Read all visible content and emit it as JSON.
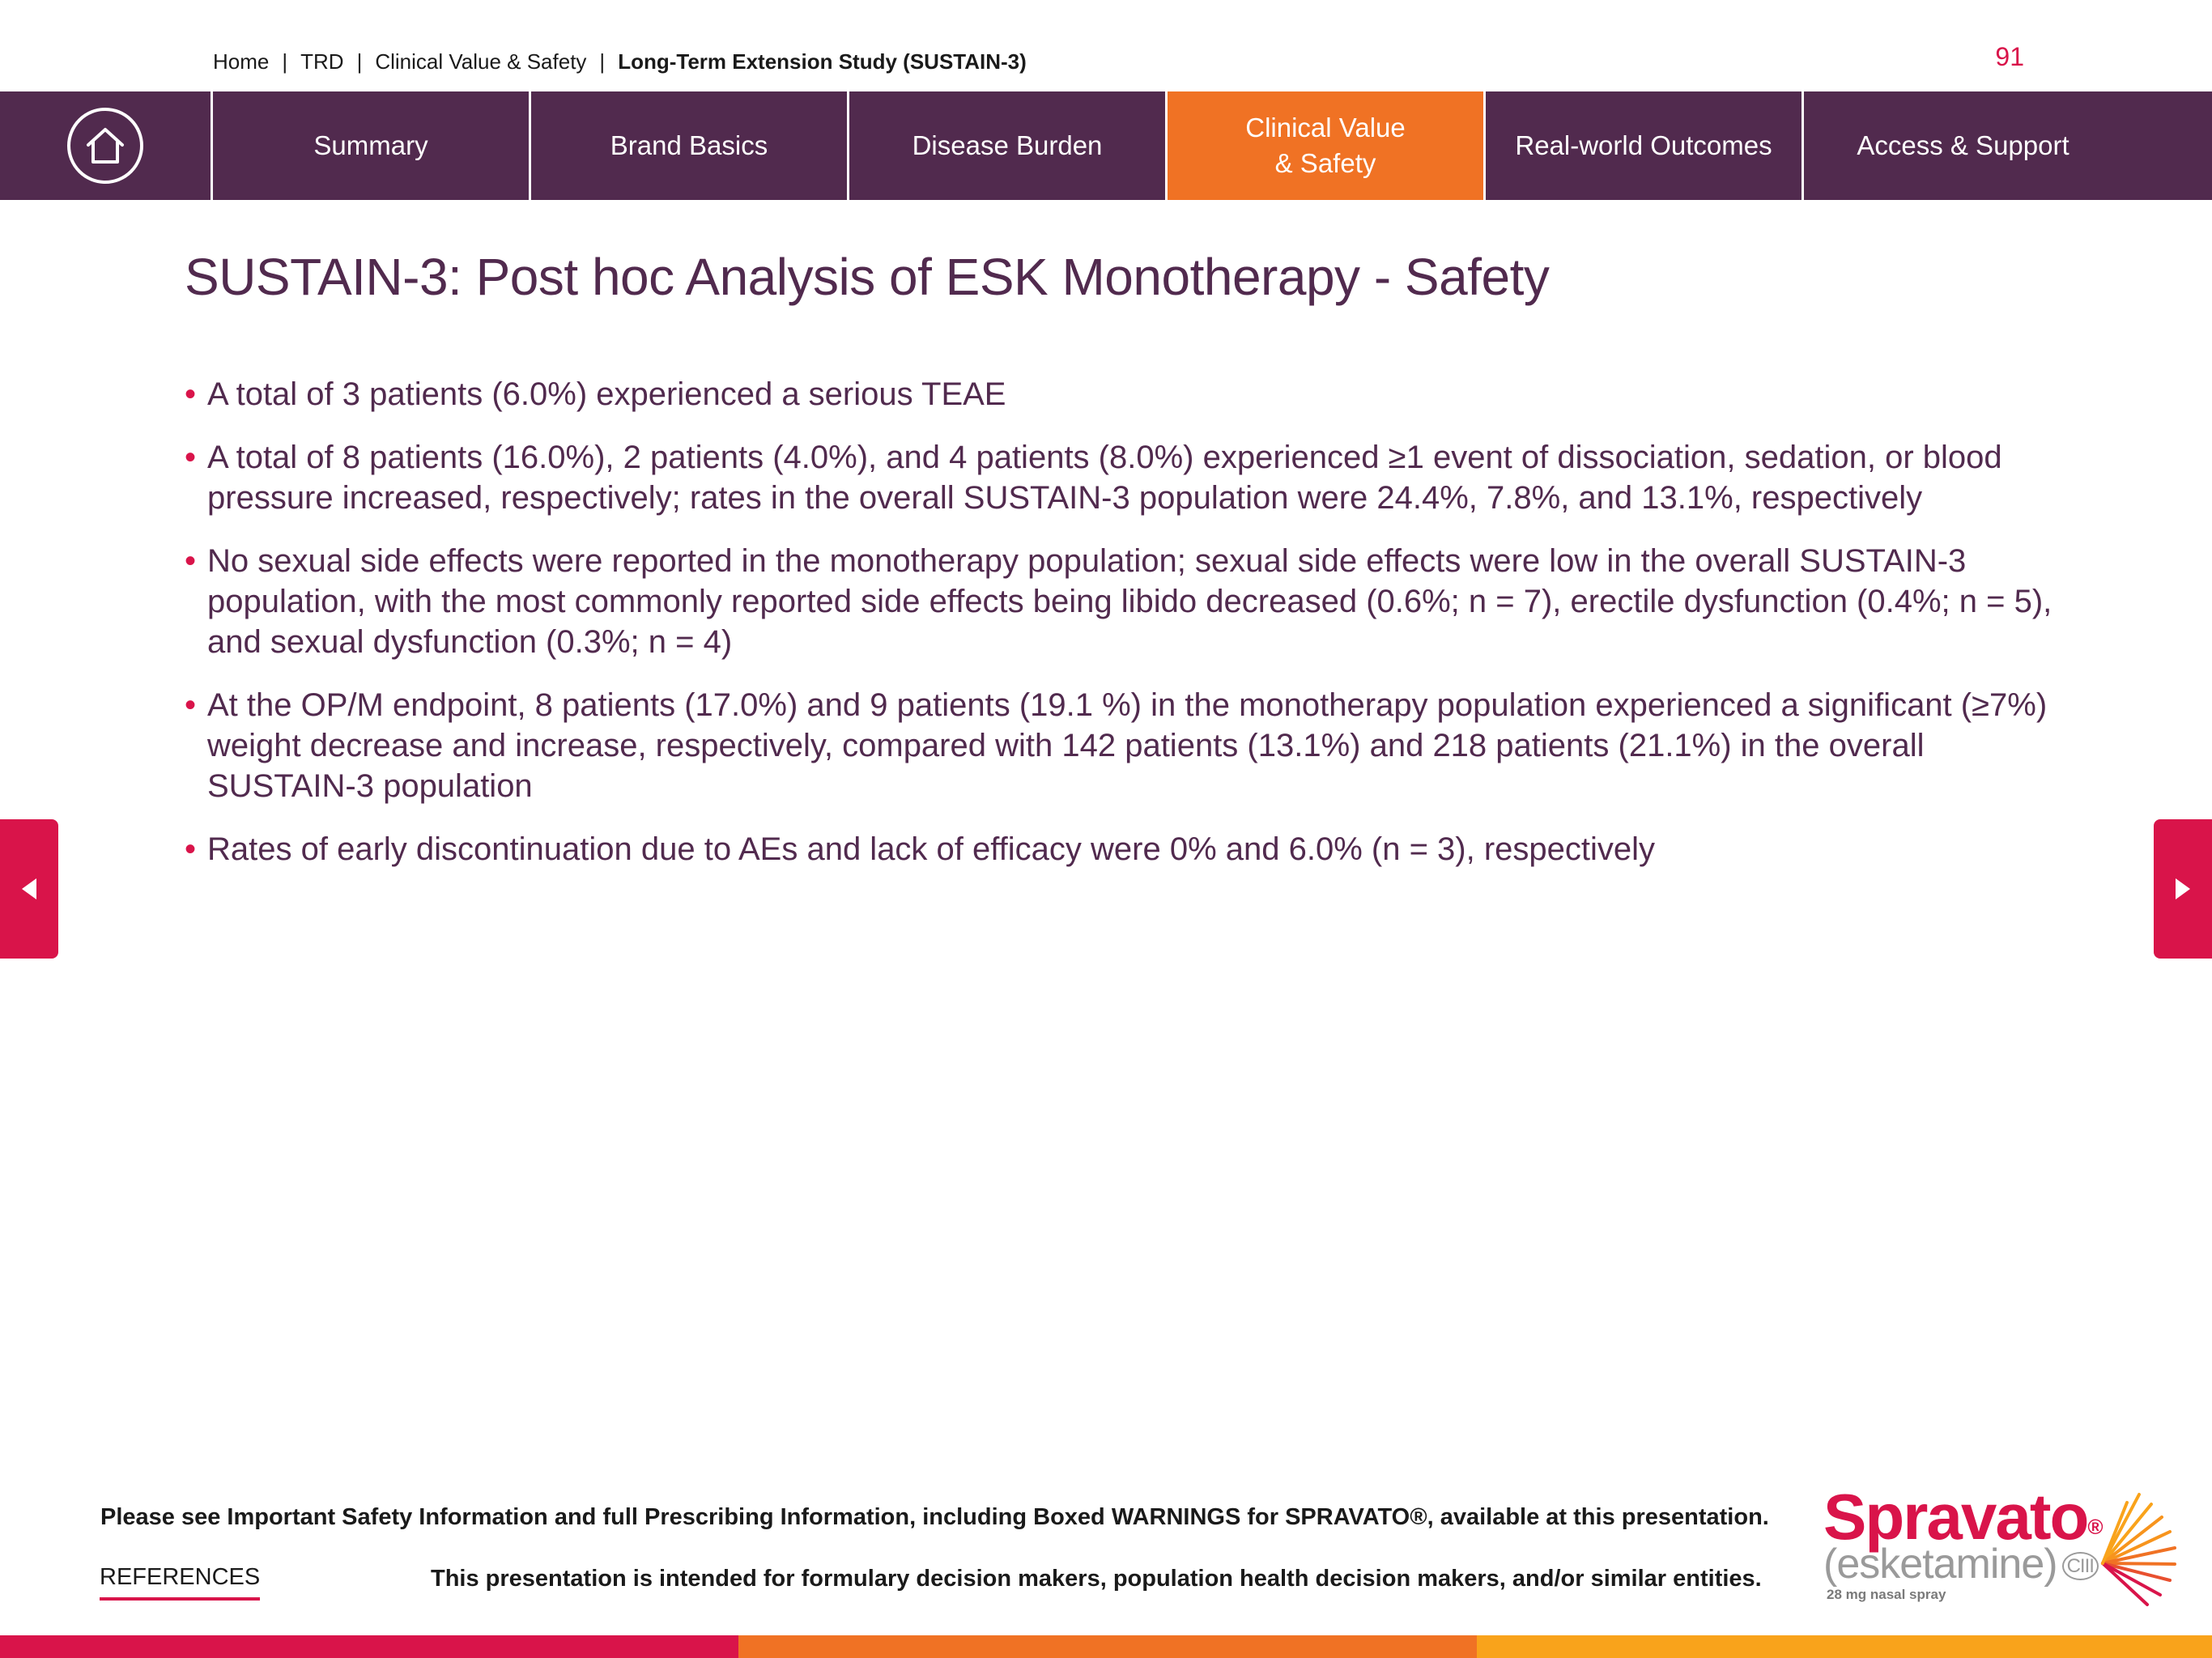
{
  "breadcrumb": {
    "items": [
      "Home",
      "TRD",
      "Clinical Value & Safety"
    ],
    "current": "Long-Term Extension Study (SUSTAIN-3)",
    "separator": "|"
  },
  "page_number": "91",
  "nav": {
    "home_icon": "home-icon",
    "tabs": [
      {
        "label": "Summary"
      },
      {
        "label": "Brand Basics"
      },
      {
        "label": "Disease Burden"
      },
      {
        "label": "Clinical Value\n& Safety",
        "line1": "Clinical Value",
        "line2": "& Safety"
      },
      {
        "label": "Real-world Outcomes"
      },
      {
        "label": "Access & Support"
      }
    ],
    "active_tab": "Clinical Value & Safety"
  },
  "main": {
    "title": "SUSTAIN-3: Post hoc Analysis of ESK Monotherapy - Safety",
    "bullets": [
      "A total of 3 patients (6.0%) experienced a serious TEAE",
      "A total of 8 patients (16.0%), 2 patients (4.0%), and 4 patients (8.0%) experienced ≥1 event of dissociation, sedation, or blood pressure increased, respectively; rates in the overall SUSTAIN-3 population were 24.4%, 7.8%, and 13.1%, respectively",
      "No sexual side effects were reported in the monotherapy population; sexual side effects were low in the overall SUSTAIN-3 population, with the most commonly reported side effects being libido decreased (0.6%; n = 7), erectile dysfunction (0.4%; n = 5), and sexual dysfunction (0.3%; n = 4)",
      "At the OP/M endpoint, 8 patients (17.0%) and 9 patients (19.1 %) in the monotherapy population experienced a significant (≥7%) weight decrease and increase, respectively, compared with 142 patients (13.1%) and 218 patients (21.1%) in the overall SUSTAIN-3 population",
      "Rates of early discontinuation due to AEs and lack of efficacy were 0% and 6.0% (n = 3), respectively"
    ],
    "bullet_glyph": "•"
  },
  "side_arrows": {
    "left": "previous-arrow-icon",
    "right": "next-arrow-icon"
  },
  "footer": {
    "isi_note": "Please see Important Safety Information and full Prescribing Information, including Boxed WARNINGS for SPRAVATO®, available at this presentation.",
    "references_label": "REFERENCES",
    "audience_note": "This presentation is intended for formulary decision makers, population health decision makers, and/or similar entities."
  },
  "logo": {
    "brand": "Spravato",
    "registered": "®",
    "generic": "(esketamine)",
    "schedule": "CIII",
    "dose": "28 mg nasal spray"
  },
  "colors": {
    "nav_bg": "#512a4e",
    "active_tab": "#f07224",
    "accent": "#d9144a",
    "text": "#512a4e",
    "bar_orange": "#f07224",
    "bar_yellow": "#f9a31b"
  }
}
